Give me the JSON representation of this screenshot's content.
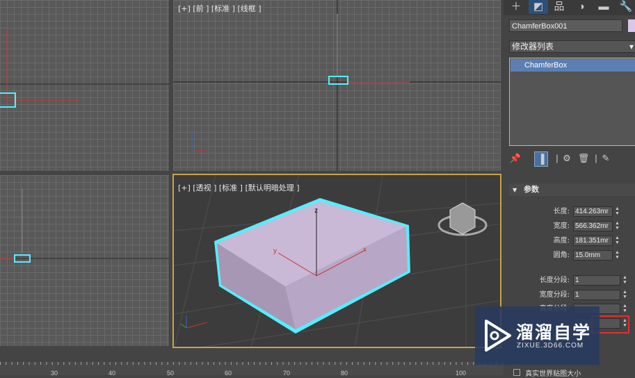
{
  "viewports": {
    "front_label": "[+] [前 ] [标准 ] [线框 ]",
    "persp_label": "[+] [透视 ] [标准 ] [默认明暗处理 ]"
  },
  "gizmo": {
    "x": "x",
    "y": "y",
    "z": "z"
  },
  "command_panel": {
    "tabs": [
      "＋",
      "◩",
      "品",
      "◑",
      "▬",
      "🔧"
    ],
    "object_name": "ChamferBox001",
    "object_color": "#d8c8e8",
    "modifier_list": "修改器列表",
    "stack_item": "ChamferBox",
    "tools": [
      "📌",
      "▐",
      "|",
      "⚙",
      "🗑",
      "|",
      "✎"
    ],
    "rollout_title": "参数",
    "params": [
      {
        "label": "长度:",
        "value": "414.263mr"
      },
      {
        "label": "宽度:",
        "value": "566.362mr"
      },
      {
        "label": "高度:",
        "value": "181.351mr"
      },
      {
        "label": "圆角:",
        "value": "15.0mm"
      }
    ],
    "segments": [
      {
        "label": "长度分段:",
        "value": "1"
      },
      {
        "label": "宽度分段:",
        "value": "1"
      },
      {
        "label": "高度分段:",
        "value": ""
      },
      {
        "label": "",
        "value": ""
      }
    ],
    "bottom_check": "真实世界贴图大小"
  },
  "ruler": {
    "ticks": [
      "30",
      "40",
      "50",
      "60",
      "70",
      "80",
      "100"
    ]
  },
  "watermark": {
    "title": "溜溜自学",
    "subtitle": "ZIXUE.3D66.COM"
  }
}
